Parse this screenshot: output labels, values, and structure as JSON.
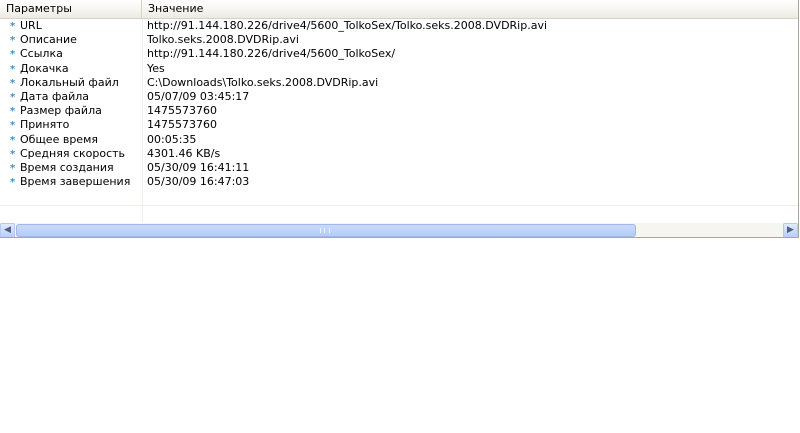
{
  "header": {
    "col_name": "Параметры",
    "col_value": "Значение"
  },
  "rows": [
    {
      "name": "URL",
      "value": "http://91.144.180.226/drive4/5600_TolkoSex/Tolko.seks.2008.DVDRip.avi"
    },
    {
      "name": "Описание",
      "value": "Tolko.seks.2008.DVDRip.avi"
    },
    {
      "name": "Ссылка",
      "value": "http://91.144.180.226/drive4/5600_TolkoSex/"
    },
    {
      "name": "Докачка",
      "value": "Yes"
    },
    {
      "name": "Локальный файл",
      "value": "C:\\Downloads\\Tolko.seks.2008.DVDRip.avi"
    },
    {
      "name": "Дата файла",
      "value": "05/07/09 03:45:17"
    },
    {
      "name": "Размер файла",
      "value": "1475573760"
    },
    {
      "name": "Принято",
      "value": "1475573760"
    },
    {
      "name": "Общее время",
      "value": "00:05:35"
    },
    {
      "name": "Средняя скорость",
      "value": "4301.46 KB/s"
    },
    {
      "name": "Время создания",
      "value": "05/30/09 16:41:11"
    },
    {
      "name": "Время завершения",
      "value": "05/30/09 16:47:03"
    }
  ],
  "row_icon": "*",
  "icons": {
    "row_marker": "asterisk-icon",
    "scroll_left": "arrow-left-icon",
    "scroll_right": "arrow-right-icon"
  },
  "colors": {
    "row_marker": "#4a8fc7",
    "scrollbar_thumb": "#b6ccf6"
  }
}
